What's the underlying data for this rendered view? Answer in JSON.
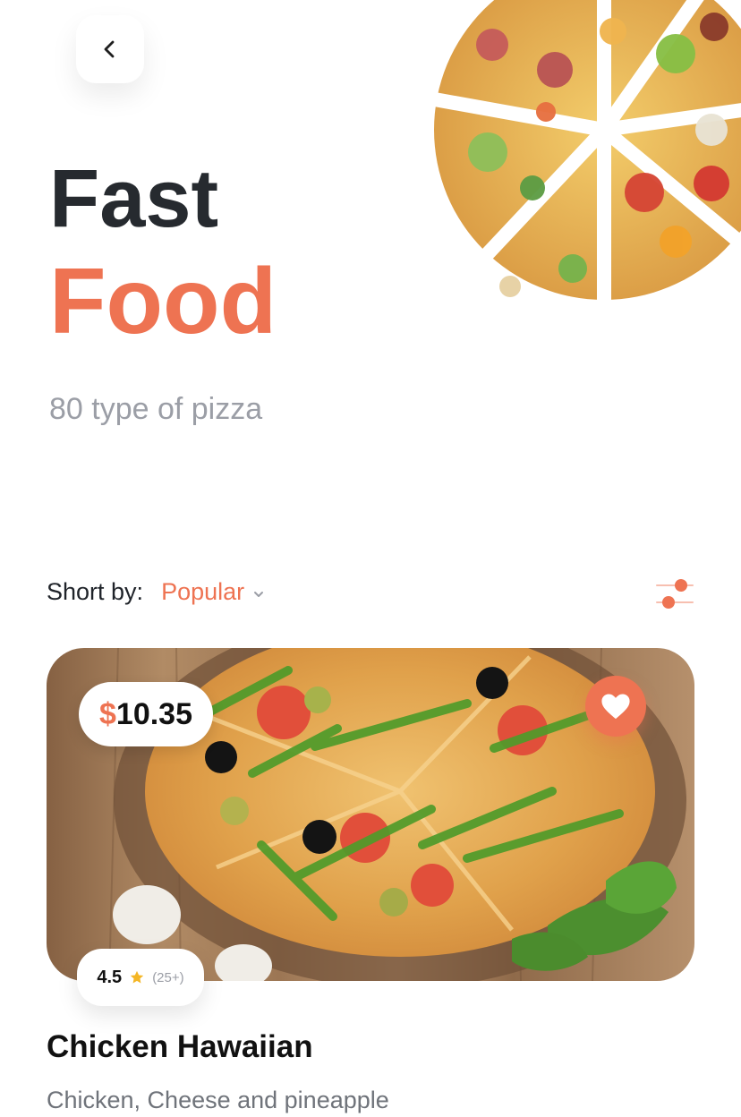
{
  "header": {
    "title_line1": "Fast",
    "title_line2": "Food",
    "subtitle": "80 type of pizza",
    "accent_color": "#ee7352",
    "title_color": "#262a2f"
  },
  "sort": {
    "label": "Short by:",
    "value": "Popular"
  },
  "card": {
    "price_currency": "$",
    "price_amount": "10.35",
    "rating": "4.5",
    "rating_count": "(25+)",
    "name": "Chicken Hawaiian",
    "description": "Chicken, Cheese and pineapple"
  },
  "icons": {
    "back": "chevron-left-icon",
    "filter": "sliders-icon",
    "favorite": "heart-icon",
    "chevron": "chevron-down-icon",
    "rating": "star-icon"
  }
}
